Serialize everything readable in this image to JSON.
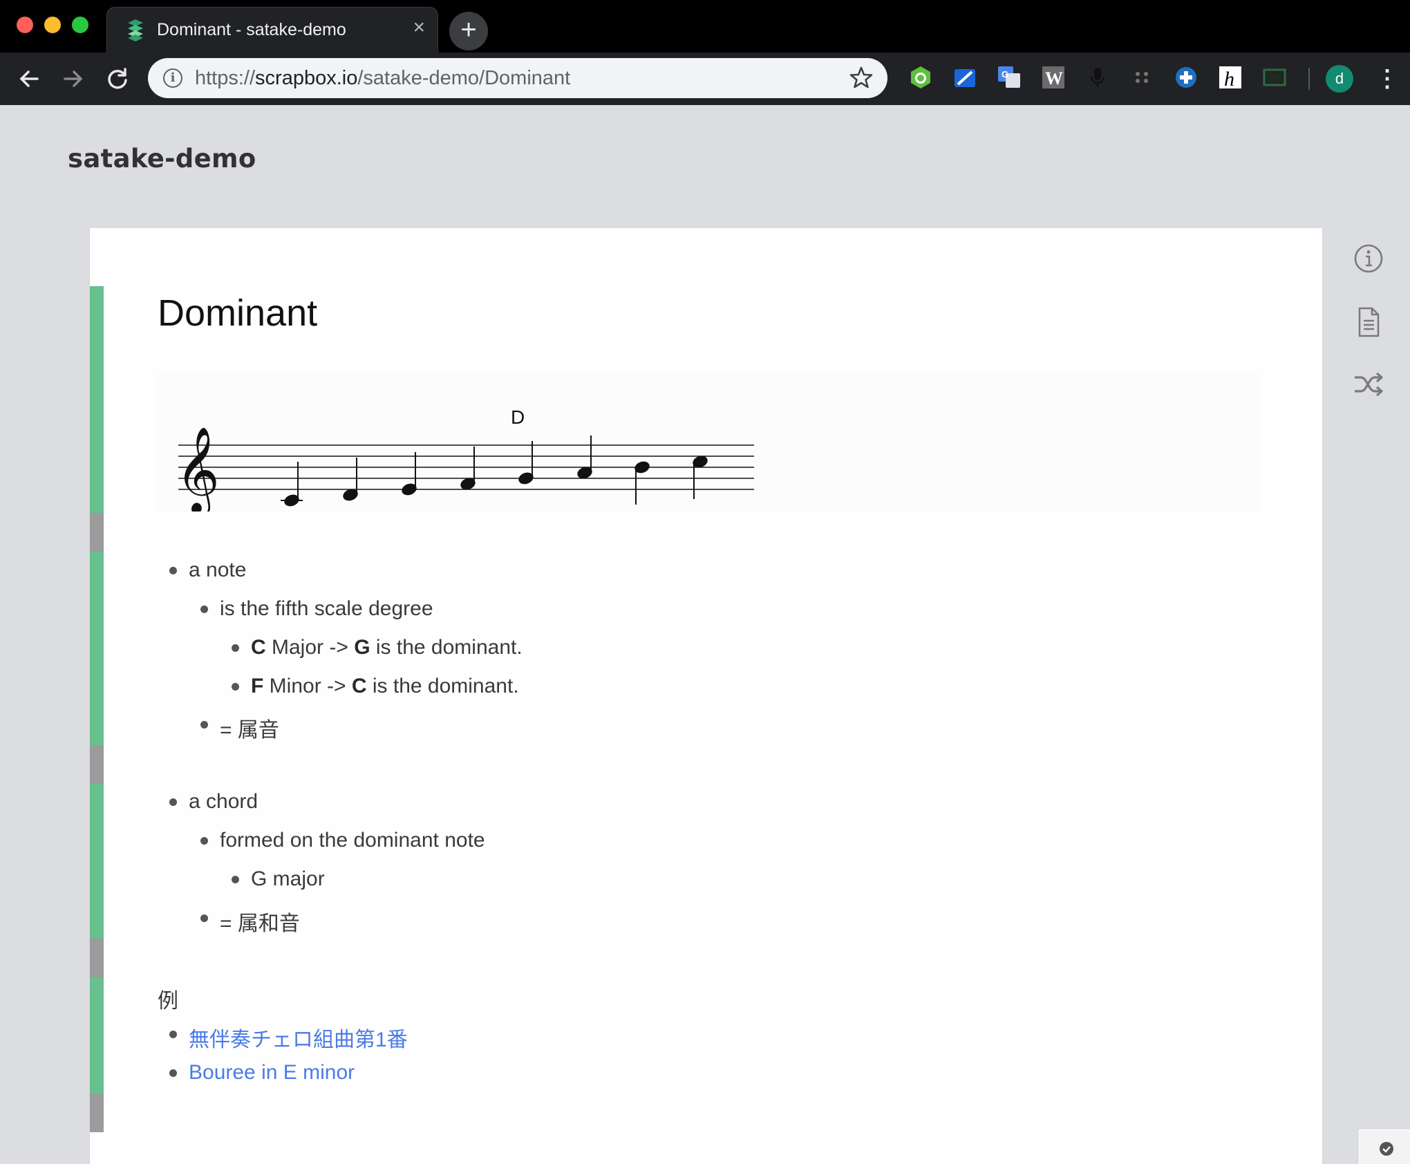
{
  "browser": {
    "tab_title": "Dominant - satake-demo",
    "tab_close_glyph": "×",
    "new_tab_glyph": "+",
    "url_scheme": "https://",
    "url_host": "scrapbox.io",
    "url_path": "/satake-demo/Dominant",
    "avatar_letter": "d",
    "extensions": [
      "evernote-icon",
      "kindle-icon",
      "translate-icon",
      "wikipedia-icon",
      "mic-icon",
      "film-icon",
      "extension-plus-icon",
      "hypothesis-icon",
      "screenshot-icon"
    ]
  },
  "page": {
    "project_name": "satake-demo",
    "title": "Dominant",
    "score_chord_label": "D",
    "items": [
      {
        "level": 1,
        "text": "a note"
      },
      {
        "level": 2,
        "text": "is the fifth scale degree"
      },
      {
        "level": 3,
        "bold1": "C",
        "mid": " Major -> ",
        "bold2": "G",
        "tail": " is the dominant."
      },
      {
        "level": 3,
        "bold1": "F",
        "mid": " Minor -> ",
        "bold2": "C",
        "tail": " is the dominant."
      },
      {
        "level": 2,
        "text": "= 属音"
      },
      {
        "level": 1,
        "text": "a chord"
      },
      {
        "level": 2,
        "text": "formed on the dominant note"
      },
      {
        "level": 3,
        "text": "G major"
      },
      {
        "level": 2,
        "text": "= 属和音"
      }
    ],
    "example_heading": "例",
    "links": [
      "無伴奏チェロ組曲第1番",
      "Bouree in E minor"
    ]
  },
  "colors": {
    "accent_green": "#67c08d",
    "link_blue": "#4b7be5"
  }
}
